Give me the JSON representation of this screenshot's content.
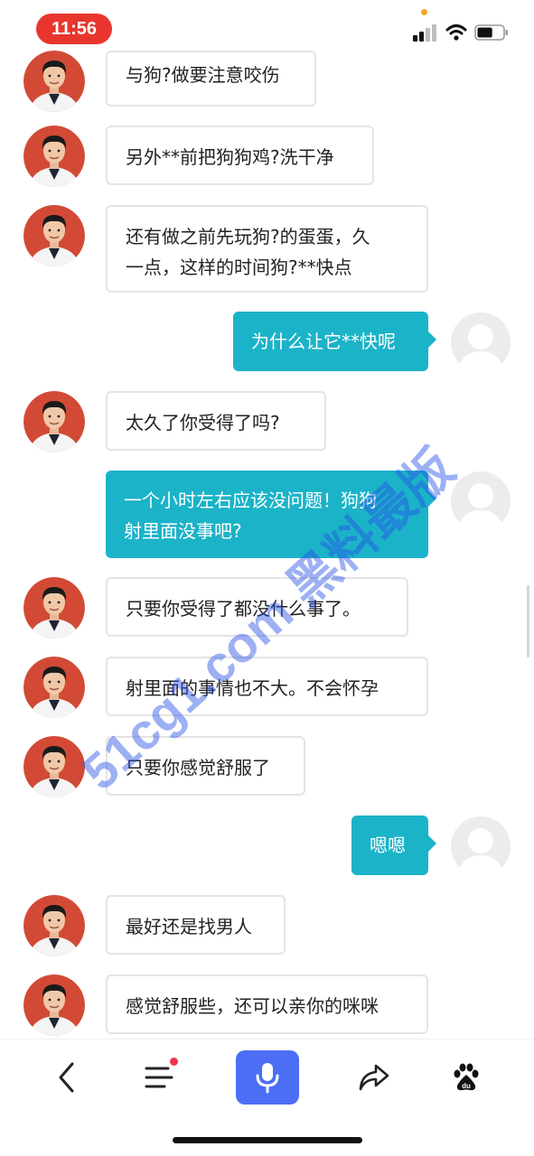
{
  "status_bar": {
    "time": "11:56",
    "battery_level": 0.6
  },
  "messages": [
    {
      "from": "other",
      "text": "与狗?做要注意咬伤"
    },
    {
      "from": "other",
      "text": "另外**前把狗狗鸡?洗干净"
    },
    {
      "from": "other",
      "text": "还有做之前先玩狗?的蛋蛋，久\n一点，这样的时间狗?**快点"
    },
    {
      "from": "me",
      "text": "为什么让它**快呢"
    },
    {
      "from": "other",
      "text": "太久了你受得了吗?"
    },
    {
      "from": "me",
      "text": "一个小时左右应该没问题！狗狗\n射里面没事吧?"
    },
    {
      "from": "other",
      "text": "只要你受得了都没什么事了。"
    },
    {
      "from": "other",
      "text": "射里面的事情也不大。不会怀孕"
    },
    {
      "from": "other",
      "text": "只要你感觉舒服了"
    },
    {
      "from": "me",
      "text": "嗯嗯"
    },
    {
      "from": "other",
      "text": "最好还是找男人"
    },
    {
      "from": "other",
      "text": "感觉舒服些，还可以亲你的咪咪"
    }
  ],
  "watermark": "51cg1.com 黑料最版",
  "toolbar": {
    "back": "back-icon",
    "menu": "menu-icon",
    "voice": "microphone-icon",
    "share": "share-icon",
    "baidu": "baidu-paw-icon"
  },
  "colors": {
    "time_pill": "#e8362e",
    "outgoing_bubble": "#1bb3c8",
    "mic_button": "#4c6ef5",
    "badge": "#f0334b"
  }
}
